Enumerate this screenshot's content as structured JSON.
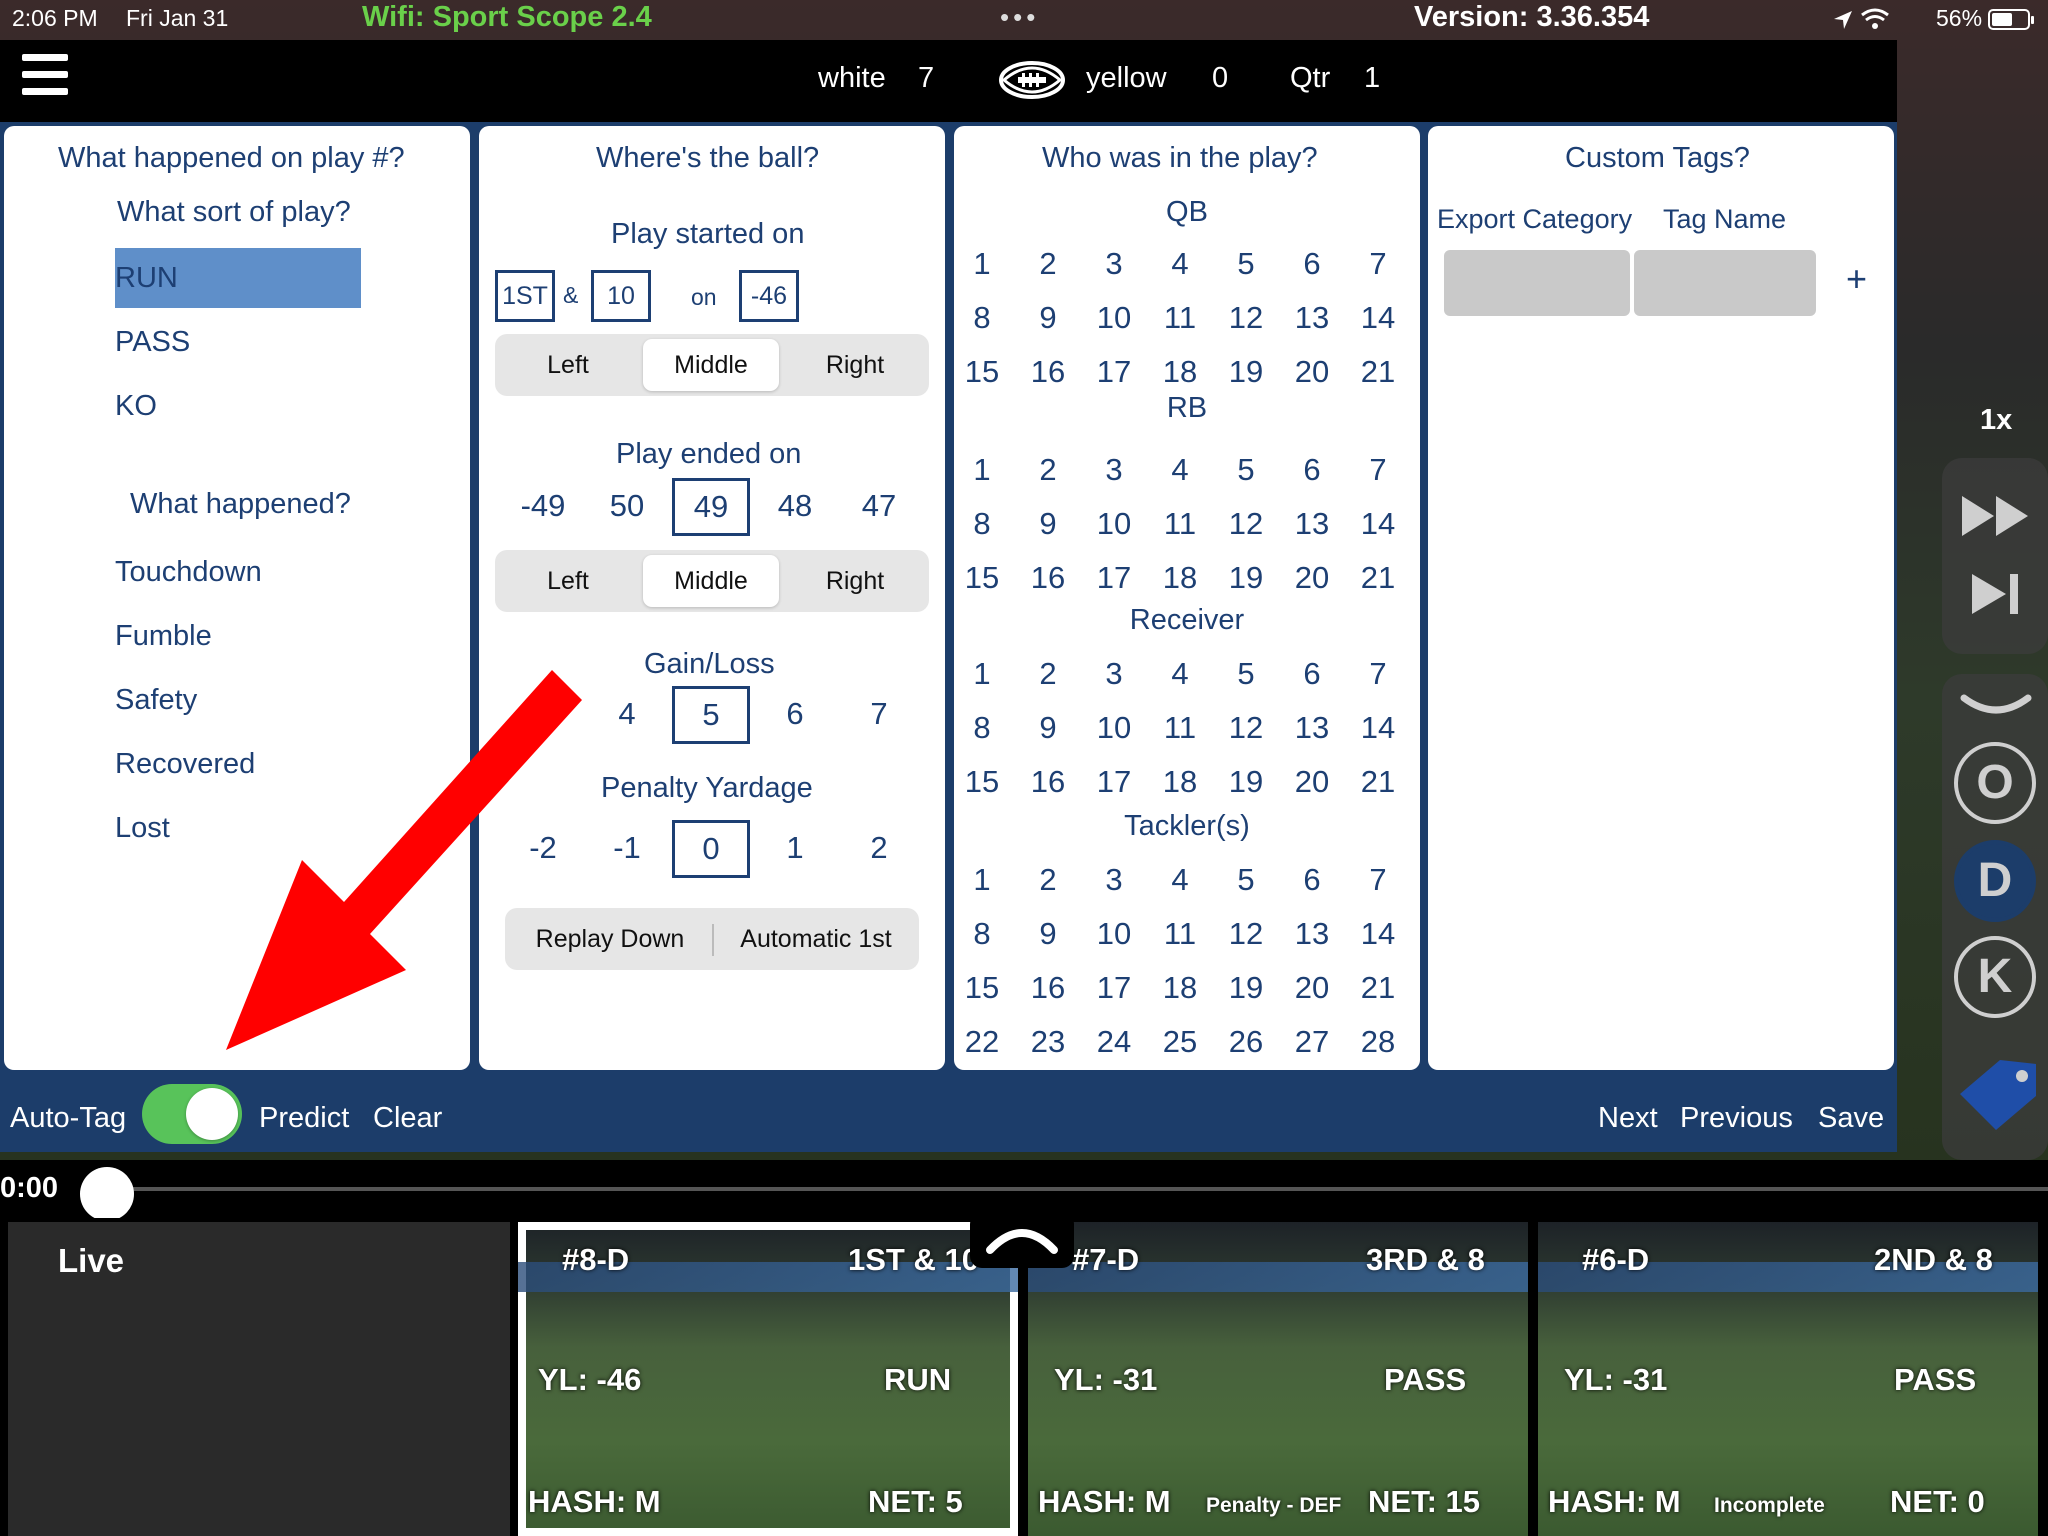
{
  "status_bar": {
    "time": "2:06 PM",
    "date": "Fri Jan 31",
    "wifi": "Wifi: Sport Scope 2.4",
    "dots": "•••",
    "version": "Version: 3.36.354",
    "battery": "56%"
  },
  "scoreboard": {
    "team1_name": "white",
    "team1_score": "7",
    "team2_name": "yellow",
    "team2_score": "0",
    "quarter_label": "Qtr",
    "quarter_value": "1"
  },
  "play_card": {
    "title": "What happened on play #?",
    "sort_title": "What sort of play?",
    "play_types": [
      "RUN",
      "PASS",
      "KO"
    ],
    "selected_play_type": "RUN",
    "happened_title": "What happened?",
    "outcomes": [
      "Touchdown",
      "Fumble",
      "Safety",
      "Recovered",
      "Lost"
    ]
  },
  "ball_card": {
    "title": "Where's the ball?",
    "started_label": "Play started on",
    "down": "1ST",
    "amp": "&",
    "distance": "10",
    "on": "on",
    "yardline": "-46",
    "hash_options": [
      "Left",
      "Middle",
      "Right"
    ],
    "start_hash_selected": "Middle",
    "ended_label": "Play ended on",
    "end_yardlines": [
      "-49",
      "50",
      "49",
      "48",
      "47"
    ],
    "end_selected": "49",
    "end_hash_selected": "Middle",
    "gain_label": "Gain/Loss",
    "gain_values": [
      "4",
      "5",
      "6",
      "7"
    ],
    "gain_selected": "5",
    "penalty_label": "Penalty Yardage",
    "penalty_values": [
      "-2",
      "-1",
      "0",
      "1",
      "2"
    ],
    "penalty_selected": "0",
    "replay_down": "Replay Down",
    "automatic_first": "Automatic 1st"
  },
  "who_card": {
    "title": "Who was in the play?",
    "groups": [
      {
        "label": "QB",
        "numbers": [
          "1",
          "2",
          "3",
          "4",
          "5",
          "6",
          "7",
          "8",
          "9",
          "10",
          "11",
          "12",
          "13",
          "14",
          "15",
          "16",
          "17",
          "18",
          "19",
          "20",
          "21"
        ]
      },
      {
        "label": "RB",
        "numbers": [
          "1",
          "2",
          "3",
          "4",
          "5",
          "6",
          "7",
          "8",
          "9",
          "10",
          "11",
          "12",
          "13",
          "14",
          "15",
          "16",
          "17",
          "18",
          "19",
          "20",
          "21"
        ]
      },
      {
        "label": "Receiver",
        "numbers": [
          "1",
          "2",
          "3",
          "4",
          "5",
          "6",
          "7",
          "8",
          "9",
          "10",
          "11",
          "12",
          "13",
          "14",
          "15",
          "16",
          "17",
          "18",
          "19",
          "20",
          "21"
        ]
      },
      {
        "label": "Tackler(s)",
        "numbers": [
          "1",
          "2",
          "3",
          "4",
          "5",
          "6",
          "7",
          "8",
          "9",
          "10",
          "11",
          "12",
          "13",
          "14",
          "15",
          "16",
          "17",
          "18",
          "19",
          "20",
          "21",
          "22",
          "23",
          "24",
          "25",
          "26",
          "27",
          "28"
        ]
      }
    ]
  },
  "tags_card": {
    "title": "Custom Tags?",
    "col1": "Export Category",
    "col2": "Tag Name",
    "add": "+"
  },
  "toolbar": {
    "auto_tag": "Auto-Tag",
    "auto_tag_on": true,
    "predict": "Predict",
    "clear": "Clear",
    "next": "Next",
    "previous": "Previous",
    "save": "Save"
  },
  "video_controls": {
    "speed": "1x",
    "o_label": "O",
    "d_label": "D",
    "k_label": "K"
  },
  "timeline": {
    "time": "0:00"
  },
  "clips": {
    "live_label": "Live",
    "items": [
      {
        "id": "#8-D",
        "down": "1ST & 10",
        "yl": "YL: -46",
        "type": "RUN",
        "hash": "HASH: M",
        "note": "",
        "net": "NET: 5"
      },
      {
        "id": "#7-D",
        "down": "3RD & 8",
        "yl": "YL: -31",
        "type": "PASS",
        "hash": "HASH: M",
        "note": "Penalty - DEF",
        "net": "NET: 15"
      },
      {
        "id": "#6-D",
        "down": "2ND & 8",
        "yl": "YL: -31",
        "type": "PASS",
        "hash": "HASH: M",
        "note": "Incomplete",
        "net": "NET: 0"
      }
    ]
  },
  "colors": {
    "panel_blue": "#1c3d6a",
    "text_blue": "#1d3f73",
    "selected_blue": "#5f8fc9",
    "toggle_green": "#58c35a",
    "wifi_green": "#6ad04a",
    "arrow_red": "#ff0000"
  }
}
